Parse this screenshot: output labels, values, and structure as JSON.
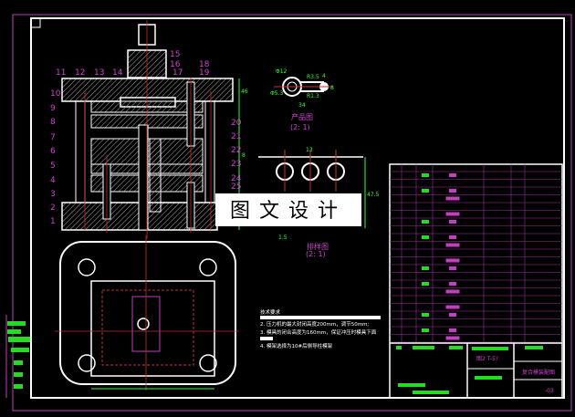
{
  "colors": {
    "background": "#000000",
    "frame": "#ffffff",
    "outer_frame": "#c040c0",
    "label": "#d040d0",
    "dimension": "#30ff30",
    "centerline": "#c03030"
  },
  "part_numbers": {
    "left": [
      "1",
      "2",
      "3",
      "4",
      "5",
      "6",
      "7",
      "8",
      "9",
      "10"
    ],
    "top": [
      "11",
      "12",
      "13",
      "14"
    ],
    "top_right": [
      "15",
      "16",
      "17",
      "18",
      "19"
    ],
    "right": [
      "20",
      "21",
      "22",
      "23",
      "24",
      "25"
    ]
  },
  "assembly_dims": {
    "height_top": "46",
    "height_total": "8"
  },
  "product_view": {
    "title": "产品图",
    "scale": "(2: 1)",
    "dims": [
      "Φ12",
      "R3.5",
      "Φ5.3",
      "R1.3",
      "34",
      "4",
      "8"
    ]
  },
  "strip_view": {
    "title": "排样图",
    "scale": "(2: 1)",
    "dims": [
      "13",
      "1.5",
      "47.5"
    ]
  },
  "watermark": "图文设计",
  "tech_notes": {
    "title": "技术要求",
    "items": [
      "2. 压力机的最大封闭高度200mm，调节50mm;",
      "3. 模具的闭合高度为160mm，保证冲压时模具下面",
      "4. 模架选择为10#后侧导柱模架"
    ]
  },
  "title_block": {
    "scale": "图2 T-5?",
    "drawing_name": "复合模装配图",
    "code": "-03"
  }
}
